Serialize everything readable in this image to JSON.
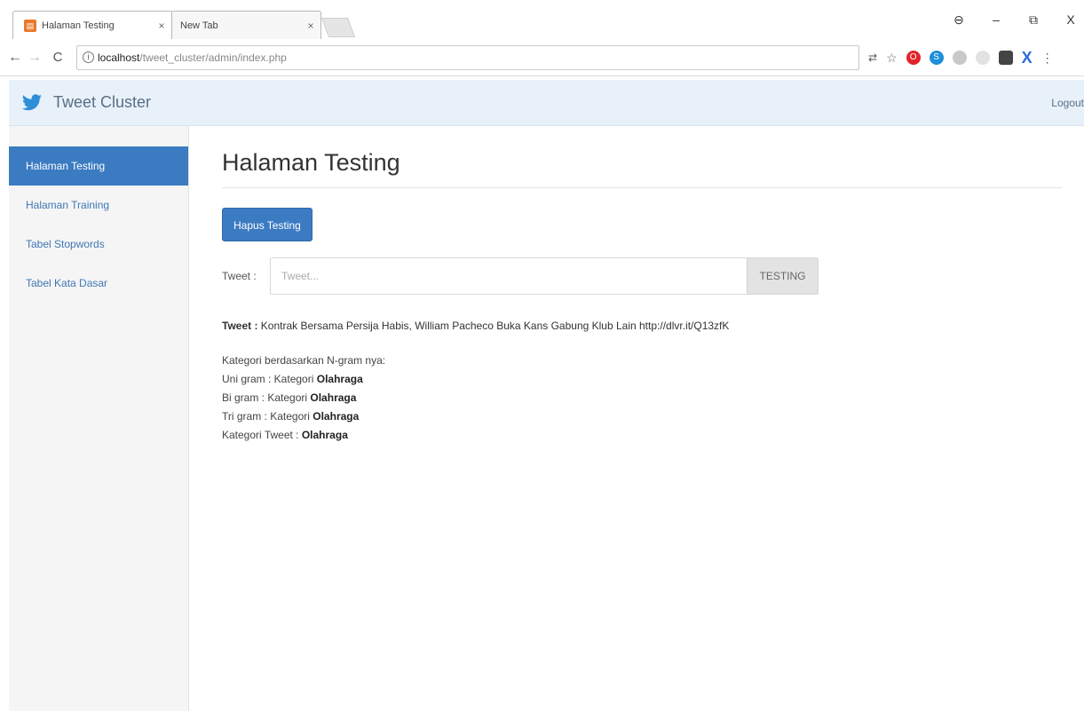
{
  "browser": {
    "tabs": [
      {
        "title": "Halaman Testing",
        "close": "×",
        "active": true
      },
      {
        "title": "New Tab",
        "close": "×",
        "active": false
      }
    ],
    "window_controls": {
      "profile": "⊖",
      "minimize": "–",
      "restore": "⧉",
      "close": "X"
    },
    "address": {
      "host": "localhost",
      "path": "/tweet_cluster/admin/index.php"
    }
  },
  "navbar": {
    "brand": "Tweet Cluster",
    "logout": "Logout"
  },
  "sidebar": {
    "items": [
      {
        "label": "Halaman Testing",
        "active": true
      },
      {
        "label": "Halaman Training",
        "active": false
      },
      {
        "label": "Tabel Stopwords",
        "active": false
      },
      {
        "label": "Tabel Kata Dasar",
        "active": false
      }
    ]
  },
  "main": {
    "title": "Halaman Testing",
    "hapus_button": "Hapus Testing",
    "tweet_label": "Tweet :",
    "tweet_placeholder": "Tweet...",
    "testing_button": "TESTING",
    "result": {
      "tweet_prefix": "Tweet :",
      "tweet_text": "Kontrak Bersama Persija Habis, William Pacheco Buka Kans Gabung Klub Lain http://dlvr.it/Q13zfK",
      "intro": "Kategori berdasarkan N-gram nya:",
      "unigram_label": "Uni gram : Kategori",
      "unigram_value": "Olahraga",
      "bigram_label": "Bi gram : Kategori",
      "bigram_value": "Olahraga",
      "trigram_label": "Tri gram : Kategori",
      "trigram_value": "Olahraga",
      "final_label": "Kategori Tweet :",
      "final_value": "Olahraga"
    }
  },
  "colors": {
    "primary": "#3b7bc2",
    "navbar_bg": "#e8f1fa",
    "sidebar_bg": "#f5f5f5"
  }
}
